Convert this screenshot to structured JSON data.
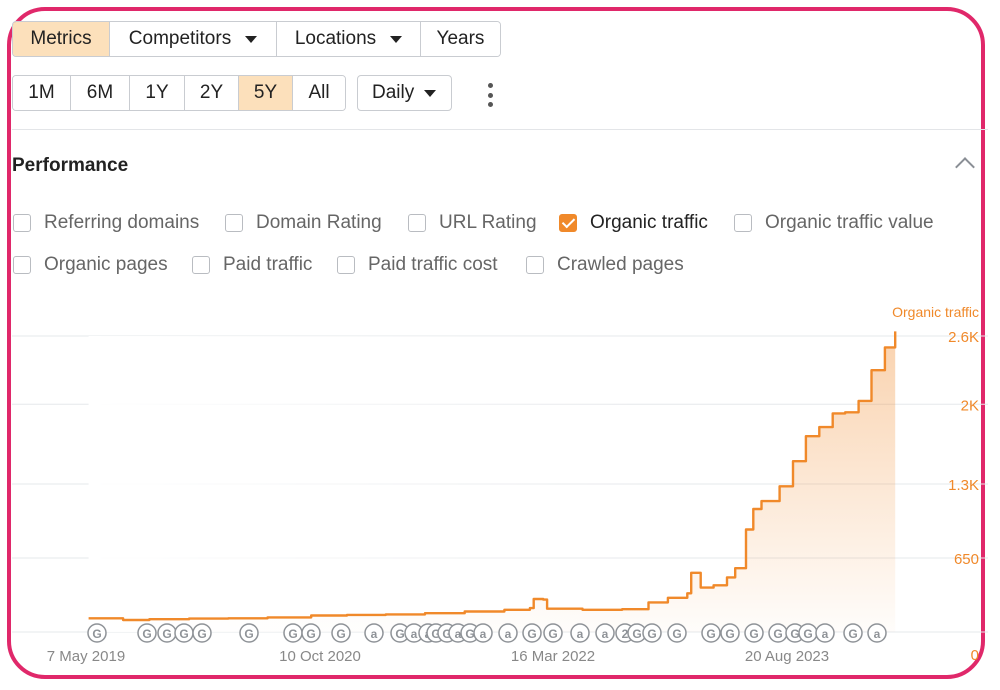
{
  "tabs": {
    "metrics": "Metrics",
    "competitors": "Competitors",
    "locations": "Locations",
    "years": "Years"
  },
  "ranges": [
    "1M",
    "6M",
    "1Y",
    "2Y",
    "5Y",
    "All"
  ],
  "active_range": "5Y",
  "interval": "Daily",
  "section_title": "Performance",
  "metrics": [
    {
      "label": "Referring domains",
      "checked": false
    },
    {
      "label": "Domain Rating",
      "checked": false
    },
    {
      "label": "URL Rating",
      "checked": false
    },
    {
      "label": "Organic traffic",
      "checked": true
    },
    {
      "label": "Organic traffic value",
      "checked": false
    },
    {
      "label": "Organic pages",
      "checked": false
    },
    {
      "label": "Paid traffic",
      "checked": false
    },
    {
      "label": "Paid traffic cost",
      "checked": false
    },
    {
      "label": "Crawled pages",
      "checked": false
    }
  ],
  "colors": {
    "accent": "#f0892a",
    "active_bg": "#fce0bb",
    "frame": "#e0286a"
  },
  "chart_data": {
    "type": "area",
    "title": "",
    "ylabel": "Organic traffic",
    "ylim": [
      0,
      2600
    ],
    "yticks": [
      0,
      650,
      1300,
      2000,
      2600
    ],
    "yticklabels": [
      "0",
      "650",
      "1.3K",
      "2K",
      "2.6K"
    ],
    "xticklabels": [
      "7 May 2019",
      "10 Oct 2020",
      "16 Mar 2022",
      "20 Aug 2023"
    ],
    "xlim": [
      "2019-05-07",
      "2024-07-20"
    ],
    "grid": true,
    "series": [
      {
        "name": "Organic traffic",
        "points": [
          [
            "2019-05-13",
            120
          ],
          [
            "2019-08-01",
            105
          ],
          [
            "2019-10-01",
            112
          ],
          [
            "2020-01-01",
            118
          ],
          [
            "2020-04-01",
            120
          ],
          [
            "2020-07-01",
            128
          ],
          [
            "2020-10-10",
            145
          ],
          [
            "2021-01-01",
            150
          ],
          [
            "2021-04-01",
            155
          ],
          [
            "2021-07-01",
            165
          ],
          [
            "2021-10-01",
            180
          ],
          [
            "2022-01-01",
            195
          ],
          [
            "2022-03-01",
            210
          ],
          [
            "2022-03-10",
            290
          ],
          [
            "2022-04-01",
            285
          ],
          [
            "2022-04-10",
            205
          ],
          [
            "2022-07-01",
            195
          ],
          [
            "2022-10-01",
            200
          ],
          [
            "2022-12-01",
            260
          ],
          [
            "2023-01-15",
            300
          ],
          [
            "2023-03-01",
            340
          ],
          [
            "2023-03-10",
            520
          ],
          [
            "2023-03-25",
            520
          ],
          [
            "2023-04-01",
            390
          ],
          [
            "2023-05-01",
            410
          ],
          [
            "2023-06-01",
            480
          ],
          [
            "2023-06-20",
            560
          ],
          [
            "2023-07-15",
            900
          ],
          [
            "2023-08-01",
            1080
          ],
          [
            "2023-08-20",
            1150
          ],
          [
            "2023-10-01",
            1280
          ],
          [
            "2023-11-01",
            1500
          ],
          [
            "2023-12-01",
            1720
          ],
          [
            "2024-01-01",
            1800
          ],
          [
            "2024-02-01",
            1920
          ],
          [
            "2024-03-01",
            1930
          ],
          [
            "2024-04-01",
            2030
          ],
          [
            "2024-05-01",
            2300
          ],
          [
            "2024-06-01",
            2500
          ],
          [
            "2024-06-25",
            2640
          ]
        ]
      }
    ],
    "annotation_markers": [
      "G",
      "G",
      "G",
      "G",
      "G",
      "G",
      "G",
      "G",
      "G",
      "a",
      "G",
      "a",
      "a",
      "G",
      "G",
      "a",
      "G",
      "a",
      "a",
      "G",
      "G",
      "a",
      "a",
      "2"
    ]
  }
}
